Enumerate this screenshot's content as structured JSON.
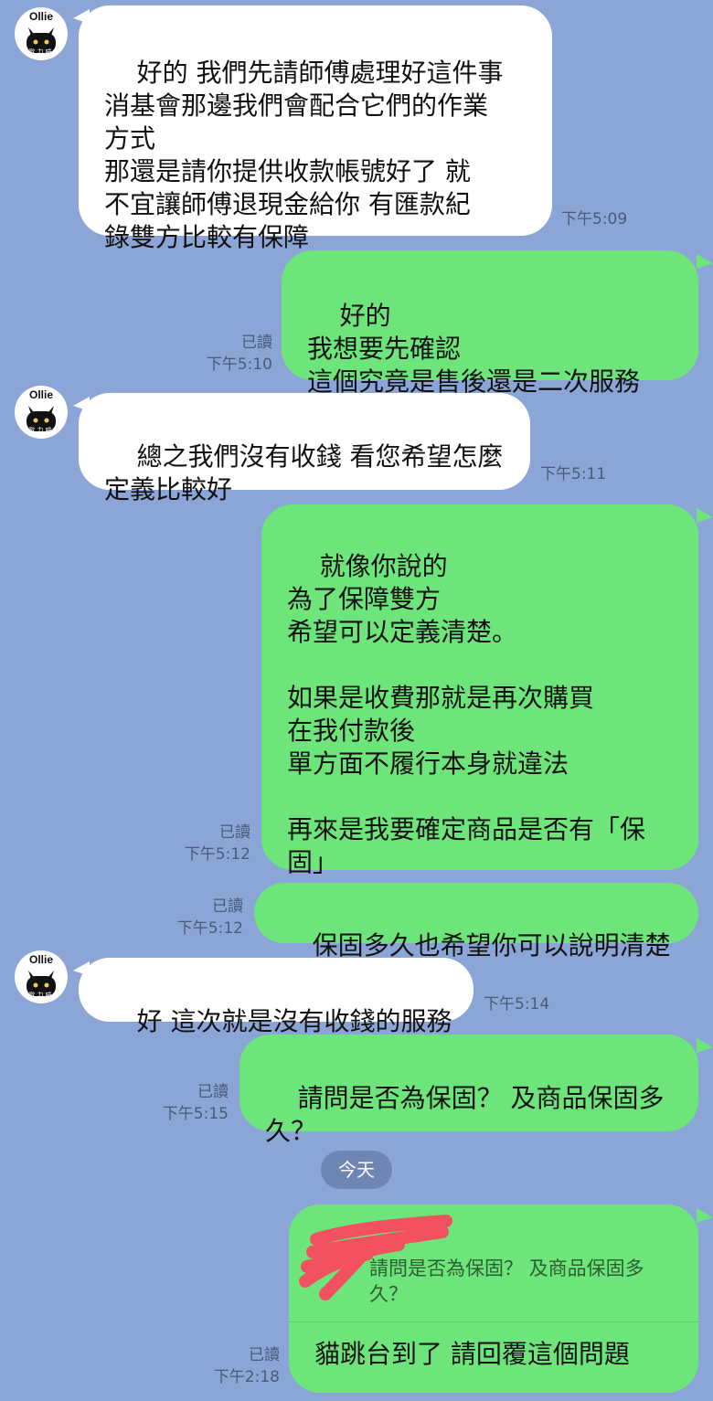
{
  "contact": {
    "avatar_name": "Ollie",
    "avatar_sub": "歐力喵"
  },
  "messages": [
    {
      "text": "好的 我們先請師傅處理好這件事\n消基會那邊我們會配合它們的作業\n方式\n那還是請你提供收款帳號好了 就\n不宜讓師傅退現金給你 有匯款紀\n錄雙方比較有保障",
      "time": "下午5:09"
    },
    {
      "text": "好的\n我想要先確認\n這個究竟是售後還是二次服務",
      "read": "已讀",
      "time": "下午5:10"
    },
    {
      "text": "總之我們沒有收錢 看您希望怎麼\n定義比較好",
      "time": "下午5:11"
    },
    {
      "text": "就像你說的\n為了保障雙方\n希望可以定義清楚。\n\n如果是收費那就是再次購買\n在我付款後\n單方面不履行本身就違法\n\n再來是我要確定商品是否有「保\n固」",
      "read": "已讀",
      "time": "下午5:12"
    },
    {
      "text": "保固多久也希望你可以說明清楚",
      "read": "已讀",
      "time": "下午5:12"
    },
    {
      "text": "好 這次就是沒有收錢的服務",
      "time": "下午5:14"
    },
    {
      "text": "請問是否為保固？ 及商品保固多\n久？",
      "read": "已讀",
      "time": "下午5:15"
    },
    {
      "quote": "請問是否為保固？ 及商品保固多\n久？",
      "text": "貓跳台到了 請回覆這個問題",
      "read": "已讀",
      "time": "下午2:18"
    }
  ],
  "date_divider": "今天",
  "colors": {
    "background": "#8aa5d6",
    "outgoing": "#6de57a",
    "incoming": "#ffffff",
    "redaction": "#f2515f"
  }
}
